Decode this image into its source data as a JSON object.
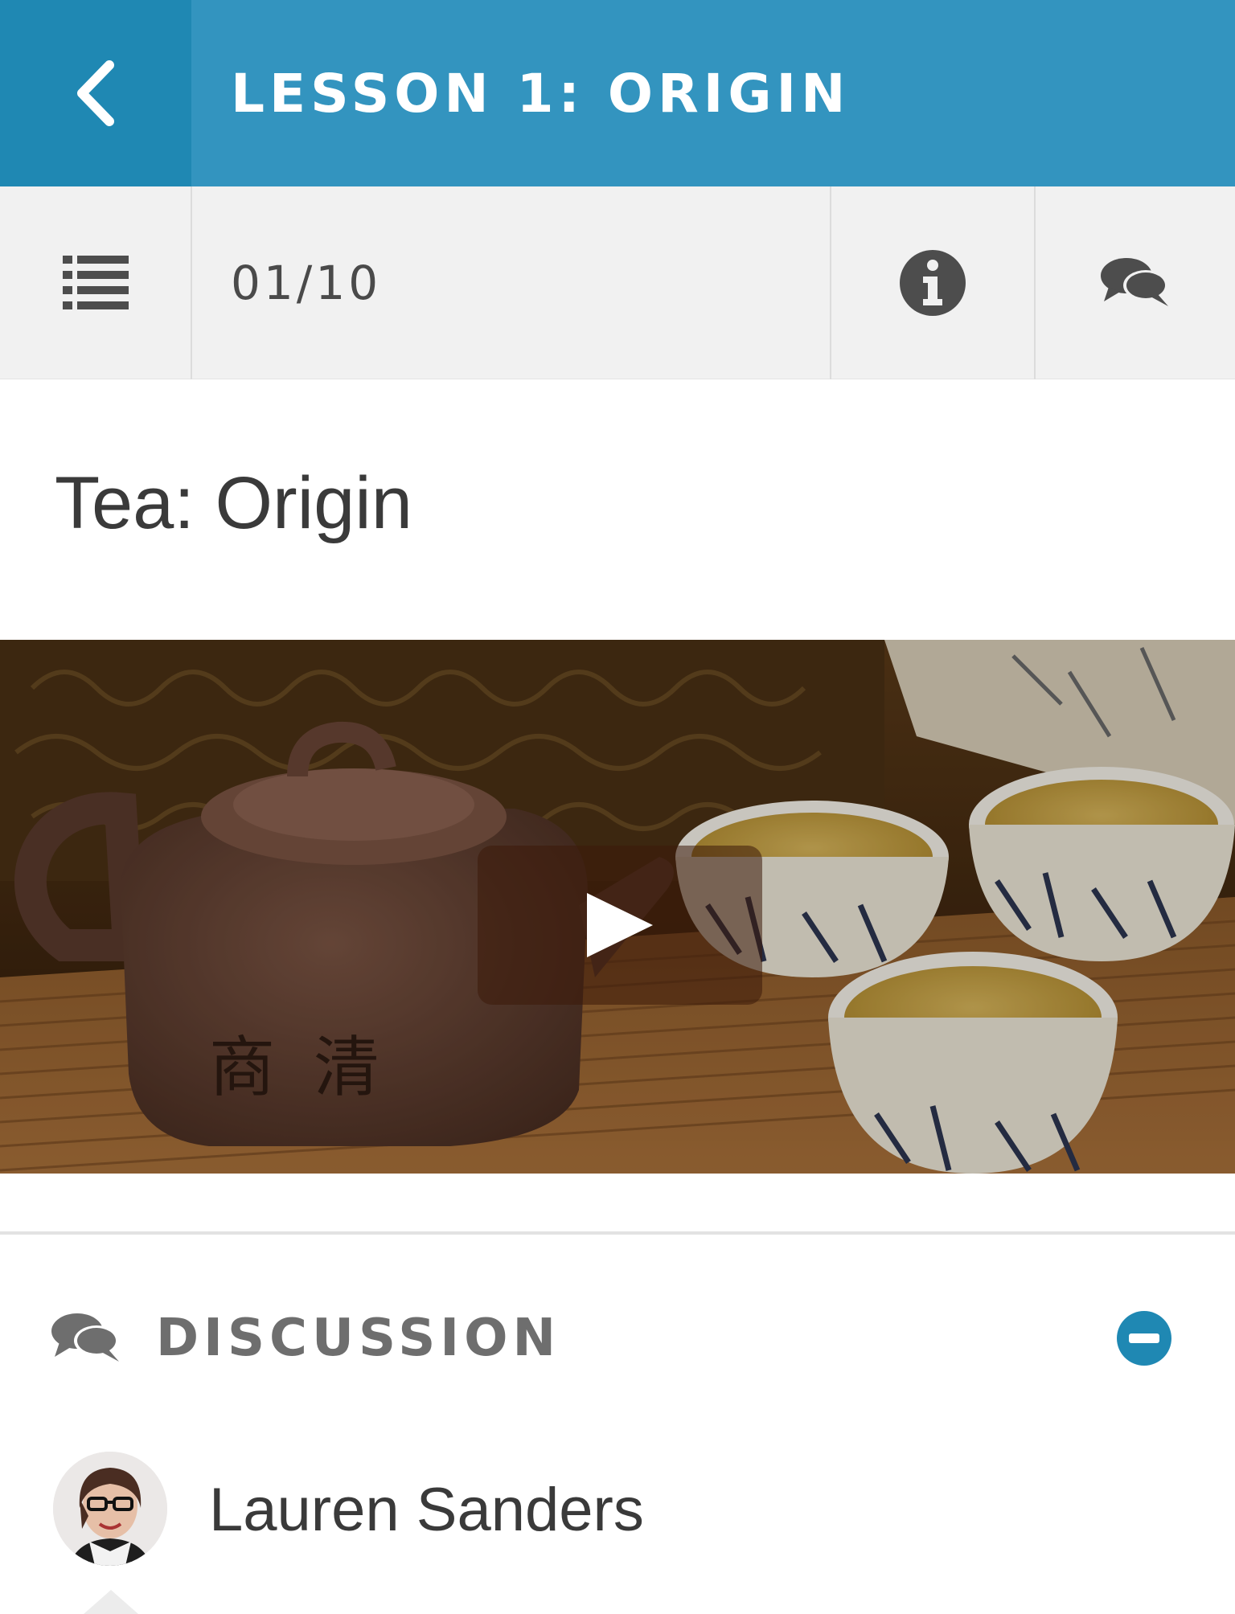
{
  "header": {
    "title": "LESSON 1: ORIGIN",
    "back_icon": "chevron-left-icon",
    "colors": {
      "bar": "#3394bf",
      "back_button": "#1f88b3"
    }
  },
  "toolbar": {
    "menu_icon": "list-icon",
    "counter": "01/10",
    "info_icon": "info-icon",
    "chat_icon": "comments-icon"
  },
  "lesson": {
    "heading": "Tea: Origin"
  },
  "video": {
    "play_icon": "play-icon"
  },
  "discussion": {
    "icon": "comments-icon",
    "title": "DISCUSSION",
    "collapse_icon": "minus-circle-icon",
    "accent": "#1f88b3",
    "comments": [
      {
        "author": "Lauren Sanders",
        "avatar": "avatar"
      }
    ]
  }
}
